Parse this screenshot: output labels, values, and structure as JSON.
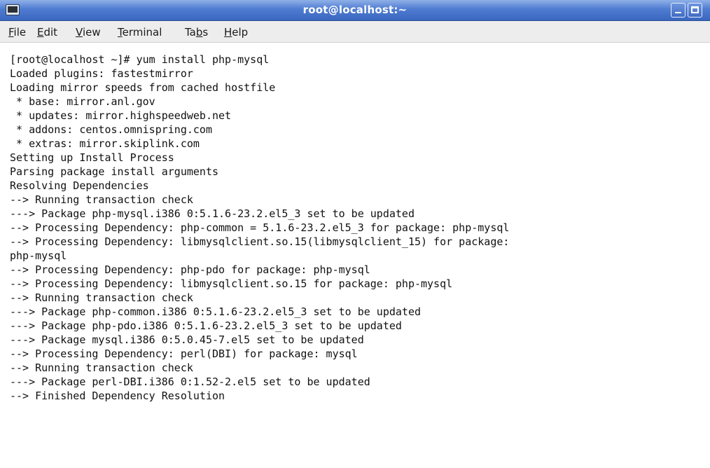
{
  "window": {
    "title": "root@localhost:~"
  },
  "menubar": {
    "items": [
      {
        "mnemonic": "F",
        "rest": "ile"
      },
      {
        "mnemonic": "E",
        "rest": "dit"
      },
      {
        "mnemonic": "V",
        "rest": "iew"
      },
      {
        "mnemonic": "T",
        "rest": "erminal"
      },
      {
        "before": "Ta",
        "mnemonic": "b",
        "rest": "s"
      },
      {
        "mnemonic": "H",
        "rest": "elp"
      }
    ]
  },
  "terminal": {
    "lines": [
      "[root@localhost ~]# yum install php-mysql",
      "Loaded plugins: fastestmirror",
      "Loading mirror speeds from cached hostfile",
      " * base: mirror.anl.gov",
      " * updates: mirror.highspeedweb.net",
      " * addons: centos.omnispring.com",
      " * extras: mirror.skiplink.com",
      "Setting up Install Process",
      "Parsing package install arguments",
      "Resolving Dependencies",
      "--> Running transaction check",
      "---> Package php-mysql.i386 0:5.1.6-23.2.el5_3 set to be updated",
      "--> Processing Dependency: php-common = 5.1.6-23.2.el5_3 for package: php-mysql",
      "--> Processing Dependency: libmysqlclient.so.15(libmysqlclient_15) for package:",
      "php-mysql",
      "--> Processing Dependency: php-pdo for package: php-mysql",
      "--> Processing Dependency: libmysqlclient.so.15 for package: php-mysql",
      "--> Running transaction check",
      "---> Package php-common.i386 0:5.1.6-23.2.el5_3 set to be updated",
      "---> Package php-pdo.i386 0:5.1.6-23.2.el5_3 set to be updated",
      "---> Package mysql.i386 0:5.0.45-7.el5 set to be updated",
      "--> Processing Dependency: perl(DBI) for package: mysql",
      "--> Running transaction check",
      "---> Package perl-DBI.i386 0:1.52-2.el5 set to be updated",
      "--> Finished Dependency Resolution"
    ]
  },
  "icons": {
    "app": "terminal-icon",
    "minimize": "minimize-icon",
    "maximize": "maximize-icon"
  }
}
